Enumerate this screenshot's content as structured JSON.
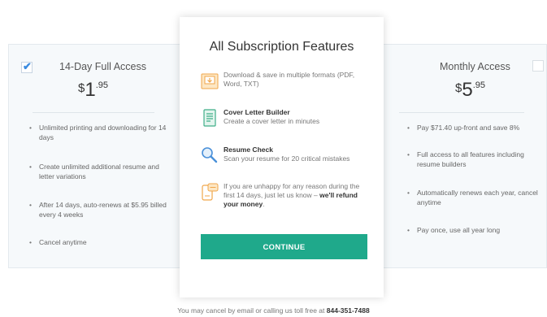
{
  "left_plan": {
    "name": "14-Day Full Access",
    "currency": "$",
    "price_whole": "1",
    "price_cents": ".95",
    "checked": true,
    "features": [
      "Unlimited printing and downloading for 14 days",
      "Create unlimited additional resume and letter variations",
      "After 14 days, auto-renews at $5.95 billed every 4 weeks",
      "Cancel anytime"
    ]
  },
  "right_plan": {
    "name": "Monthly Access",
    "currency": "$",
    "price_whole": "5",
    "price_cents": ".95",
    "checked": false,
    "features": [
      "Pay $71.40 up-front and save 8%",
      "Full access to all features including resume builders",
      "Automatically renews each year, cancel anytime",
      "Pay once, use all year long"
    ]
  },
  "modal": {
    "title": "All Subscription Features",
    "download": {
      "icon": "download-save-icon",
      "text": "Download & save in multiple formats (PDF, Word, TXT)"
    },
    "cover_letter": {
      "icon": "cover-letter-icon",
      "title": "Cover Letter Builder",
      "text": "Create a cover letter in minutes"
    },
    "resume_check": {
      "icon": "magnifier-icon",
      "title": "Resume Check",
      "text": "Scan your resume for 20 critical mistakes"
    },
    "refund": {
      "icon": "refund-phone-icon",
      "text": "If you are unhappy for any reason during the first 14 days, just let us know – ",
      "bold": "we'll refund your money",
      "tail": "."
    },
    "continue_label": "CONTINUE"
  },
  "footer": {
    "text": "You may cancel by email or calling us toll free at ",
    "phone": "844-351-7488"
  },
  "colors": {
    "accent": "#1fa98b",
    "check": "#3a8be0",
    "icon_orange": "#f0a64a",
    "icon_green": "#3fae88",
    "icon_blue": "#4a90d9"
  }
}
